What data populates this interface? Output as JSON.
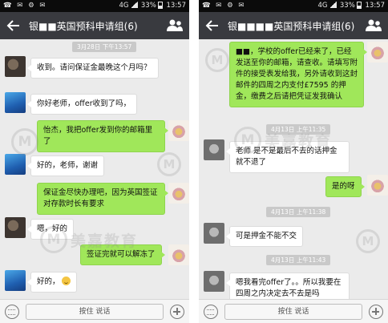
{
  "status": {
    "left": "☎ ✉ ⚙ ✉",
    "network": "4G",
    "battery": "33%",
    "time": "13:57"
  },
  "watermark": {
    "logo": "M",
    "text": "美嘉教育"
  },
  "left_chat": {
    "title": "银■■英国预科申请组(6)",
    "messages": [
      {
        "type": "in",
        "avatar": "dark",
        "text": "收到。请问保证金最晚这个月吗？"
      },
      {
        "type": "in",
        "avatar": "blue",
        "text": "你好老师，offer收到了吗，"
      },
      {
        "type": "out",
        "avatar": "flower",
        "text": "怡杰，我把offer发到你的邮箱里了"
      },
      {
        "type": "in",
        "avatar": "blue",
        "text": "好的，老师，谢谢"
      },
      {
        "type": "out",
        "avatar": "flower",
        "text": "保证金尽快办理吧，因为英国签证对存款时长有要求"
      },
      {
        "type": "in",
        "avatar": "dark",
        "text": "嗯，好的"
      },
      {
        "type": "out",
        "avatar": "flower",
        "text": "签证完就可以解冻了"
      },
      {
        "type": "in",
        "avatar": "blue",
        "text": "好的，"
      }
    ],
    "timestamp": "3月28日 下午13:57"
  },
  "right_chat": {
    "title": "银■■■■英国预科申请组(6)",
    "messages": [
      {
        "type": "out",
        "avatar": "flower",
        "text": "■■，学校的offer已经来了，已经发送至你的邮箱，请查收。请填写附件的接受表发给我，另外请收到这封邮件的四周之内支付£7595 的押金，缴费之后请把凭证发我确认"
      },
      {
        "type": "in",
        "avatar": "gray",
        "text": "老师 是不是最后不去的话押金就不退了"
      },
      {
        "type": "out",
        "avatar": "flower",
        "text": "是的呀"
      },
      {
        "type": "in",
        "avatar": "gray",
        "text": "可是押金不能不交"
      },
      {
        "type": "in",
        "avatar": "gray",
        "text": "嗯我看完offer了。。所以我要在四周之内决定去不去是吗"
      }
    ],
    "timestamps": [
      "4月13日 上午11:35",
      "4月13日 上午11:38",
      "4月13日 上午11:43",
      "4月13日 上午11:46"
    ]
  },
  "input": {
    "hold_to_talk": "按住 说话"
  }
}
